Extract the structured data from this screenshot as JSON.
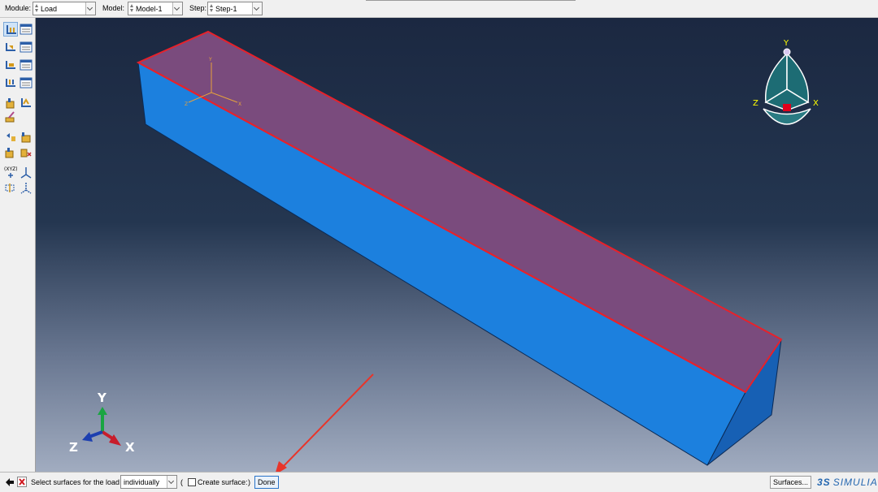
{
  "context_bar": {
    "module_label": "Module:",
    "module_value": "Load",
    "model_label": "Model:",
    "model_value": "Model-1",
    "step_label": "Step:",
    "step_value": "Step-1"
  },
  "toolbox": {
    "icons": [
      "create-load-icon",
      "load-manager-icon",
      "create-bc-icon",
      "bc-manager-icon",
      "create-predefined-field-icon",
      "predefined-field-manager-icon",
      "create-load-case-icon",
      "load-case-manager-icon",
      "create-field-icon",
      "amplitude-icon",
      "tools-surface-icon",
      "query-icon",
      "partition-icon",
      "datum-icon",
      "coord-system-icon",
      "csys-axis-icon",
      "datum-point-icon",
      "datum-plane-icon"
    ]
  },
  "triad": {
    "y": "Y",
    "z": "Z",
    "x": "X"
  },
  "view_cube": {
    "y": "Y",
    "z": "Z",
    "x": "X"
  },
  "prompt": {
    "text": "Select surfaces for the load",
    "method_value": "individually",
    "open_paren": "(",
    "create_surface_label": "Create surface:",
    "close_paren": ")",
    "done_label": "Done",
    "surfaces_label": "Surfaces...",
    "logo_text": "SIMULIA",
    "logo_prefix": "3S"
  },
  "colors": {
    "part_front": "#1c7fdc",
    "part_top": "#7b4a7c",
    "part_end": "#1760b4",
    "selection_edge": "#e8212a",
    "arrow": "#e8352a"
  }
}
